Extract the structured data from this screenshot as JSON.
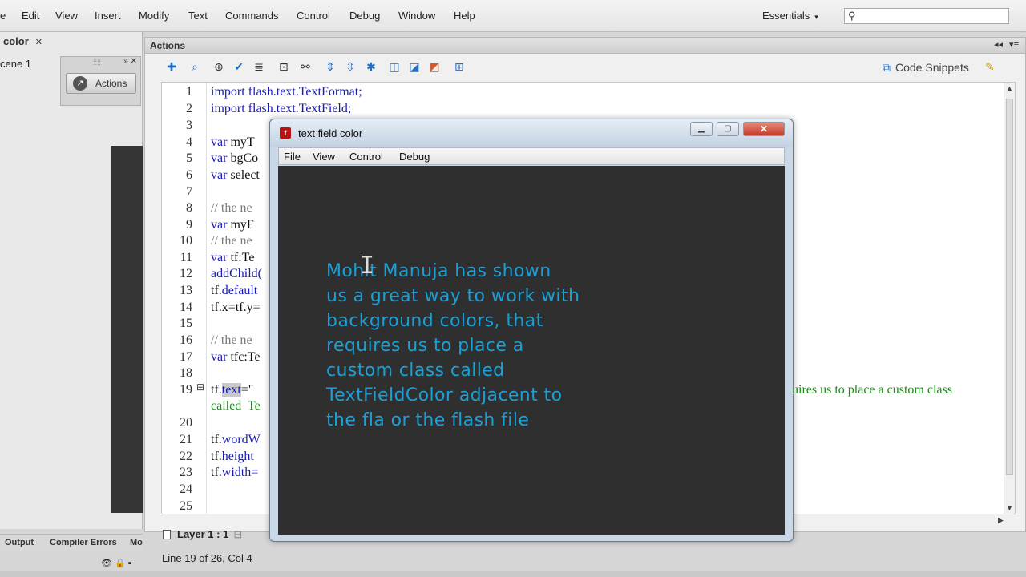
{
  "menubar": {
    "items": [
      "e",
      "Edit",
      "View",
      "Insert",
      "Modify",
      "Text",
      "Commands",
      "Control",
      "Debug",
      "Window",
      "Help"
    ],
    "workspace": "Essentials",
    "workspace_caret": "▾",
    "search_icon": "⚲"
  },
  "left_panel": {
    "doc_tab": "color",
    "doc_tab_close": "✕",
    "scene": "cene 1",
    "mini_panel_controls": "» ✕",
    "actions_button": "Actions"
  },
  "actions_panel": {
    "title": "Actions",
    "collapse": "◂◂",
    "menu": "▾≡",
    "code_snippets": "Code Snippets",
    "layer_tab": "Layer 1 : 1",
    "status": "Line 19 of 26, Col 4",
    "toolbar_icons": [
      "add-icon",
      "find-icon",
      "target-icon",
      "check-icon",
      "format-icon",
      "debug-icon",
      "insert-icon",
      "collapse-icon",
      "expand-icon",
      "collapse-selection-icon",
      "comment-icon",
      "uncomment-icon",
      "remove-comment-icon",
      "show-hide-icon"
    ],
    "line_numbers": [
      "1",
      "2",
      "3",
      "4",
      "5",
      "6",
      "7",
      "8",
      "9",
      "10",
      "11",
      "12",
      "13",
      "14",
      "15",
      "16",
      "17",
      "18",
      "19",
      "",
      "20",
      "21",
      "22",
      "23",
      "24",
      "25"
    ],
    "code": {
      "l1_kw": "import",
      "l1_rest": " flash.text.TextFormat;",
      "l2_kw": "import",
      "l2_rest": " flash.text.TextField;",
      "l4_kw": "var",
      "l4_rest": " myT",
      "l5_kw": "var",
      "l5_rest": " bgCo",
      "l6_kw": "var",
      "l6_rest": " select",
      "l8": "// the ne",
      "l9_kw": "var",
      "l9_rest": " myF",
      "l10": "// the ne",
      "l11_kw": "var",
      "l11_rest": " tf:Te",
      "l12": "addChild(",
      "l13_a": "tf.",
      "l13_b": "default",
      "l14_a": "tf.x=tf.y=",
      "l16": "// the ne",
      "l17_kw": "var",
      "l17_rest": " tfc:Te",
      "l19_a": "tf.",
      "l19_sel": "text",
      "l19_b": "=\"",
      "l19_right": "uires us to place a custom class",
      "l19_cont": "called  Te",
      "l21_a": "tf.",
      "l21_b": "wordW",
      "l22_a": "tf.",
      "l22_b": "height ",
      "l23_a": "tf.",
      "l23_b": "width="
    }
  },
  "bottom_tabs": [
    "Output",
    "Compiler Errors",
    "Mo"
  ],
  "bottom_icons": "👁 🔒 ▪",
  "flash_window": {
    "title": "text field color",
    "icon_letter": "f",
    "btn_minimize": "▁",
    "btn_maximize": "▢",
    "btn_close": "✕",
    "menus": [
      "File",
      "View",
      "Control",
      "Debug"
    ],
    "stage_text": "Mohit Manuja has shown\nus a great way to work with\nbackground colors, that\nrequires us to place a\ncustom class called\nTextFieldColor adjacent to\nthe fla or  the flash file",
    "cursor": "I",
    "text_color": "#1aa0d6",
    "stage_color": "#2f2f2f"
  }
}
